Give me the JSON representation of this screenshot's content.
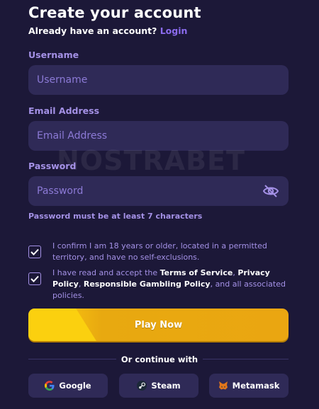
{
  "header": {
    "title": "Create your account",
    "have_account": "Already have an account?",
    "login_link": "Login"
  },
  "form": {
    "username": {
      "label": "Username",
      "placeholder": "Username",
      "value": ""
    },
    "email": {
      "label": "Email Address",
      "placeholder": "Email Address",
      "value": ""
    },
    "password": {
      "label": "Password",
      "placeholder": "Password",
      "value": "",
      "hint": "Password must be at least 7 characters",
      "toggle_icon": "eye-off-icon"
    }
  },
  "consents": {
    "age": {
      "checked": true,
      "text": "I confirm I am 18 years or older, located in a permitted territory, and have no self-exclusions."
    },
    "terms": {
      "checked": true,
      "prefix": "I have read and accept the ",
      "terms_link": "Terms of Service",
      "sep1": ", ",
      "privacy_link": "Privacy Policy",
      "sep2": ",",
      "rg_link": "Responsible Gambling Policy",
      "suffix": ", and all associated policies."
    }
  },
  "actions": {
    "play_now": "Play Now",
    "or_continue": "Or continue with",
    "social": [
      {
        "label": "Google",
        "icon": "google-icon"
      },
      {
        "label": "Steam",
        "icon": "steam-icon"
      },
      {
        "label": "Metamask",
        "icon": "metamask-icon"
      }
    ]
  },
  "watermark": "NOSTRABET",
  "colors": {
    "background": "#1c1838",
    "field": "#2f2a57",
    "accent": "#8c6cf0",
    "label": "#a491e6",
    "button": "#eaa611"
  }
}
